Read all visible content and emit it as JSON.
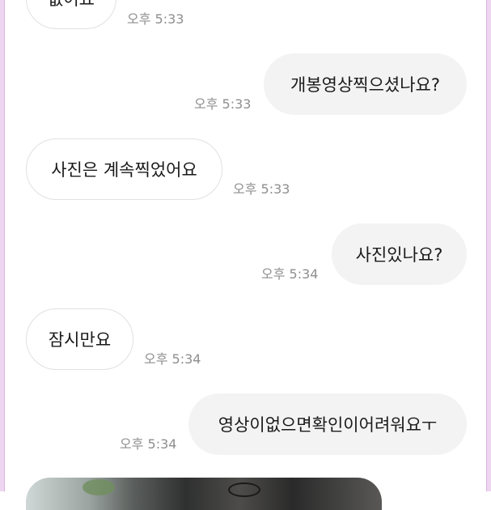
{
  "messages": [
    {
      "side": "in",
      "text": "없어요",
      "time": "오후 5:33"
    },
    {
      "side": "out",
      "text": "개봉영상찍으셨나요?",
      "time": "오후 5:33"
    },
    {
      "side": "in",
      "text": "사진은 계속찍었어요",
      "time": "오후 5:33"
    },
    {
      "side": "out",
      "text": "사진있나요?",
      "time": "오후 5:34"
    },
    {
      "side": "in",
      "text": "잠시만요",
      "time": "오후 5:34"
    },
    {
      "side": "out",
      "text": "영상이없으면확인이어려워요ㅜ",
      "time": "오후 5:34"
    }
  ],
  "colors": {
    "incoming_bubble": "#ffffff",
    "outgoing_bubble": "#f3f3f4",
    "timestamp": "#8e8e8e",
    "frame": "#eed6f1"
  }
}
